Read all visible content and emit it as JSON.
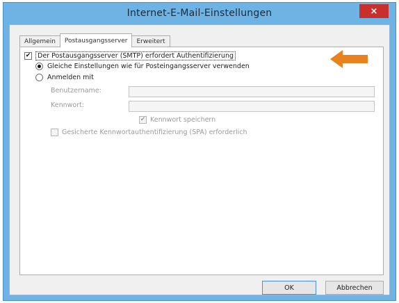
{
  "window": {
    "title": "Internet-E-Mail-Einstellungen",
    "close_glyph": "×"
  },
  "tabs": [
    {
      "label": "Allgemein",
      "active": false
    },
    {
      "label": "Postausgangsserver",
      "active": true
    },
    {
      "label": "Erweitert",
      "active": false
    }
  ],
  "smtp_auth": {
    "label": "Der Postausgangsserver (SMTP) erfordert Authentifizierung",
    "checked": true,
    "checkmark": "✔"
  },
  "options": {
    "same_settings": {
      "label": "Gleiche Einstellungen wie für Posteingangsserver verwenden",
      "selected": true
    },
    "login_with": {
      "label": "Anmelden mit",
      "selected": false
    }
  },
  "fields": {
    "username_label": "Benutzername:",
    "password_label": "Kennwort:",
    "username_value": "",
    "password_value": ""
  },
  "save_password": {
    "label": "Kennwort speichern",
    "checked": true,
    "checkmark": "✔"
  },
  "spa": {
    "label": "Gesicherte Kennwortauthentifizierung (SPA) erforderlich",
    "checked": false
  },
  "buttons": {
    "ok": "OK",
    "cancel": "Abbrechen"
  },
  "colors": {
    "arrow": "#e8821e",
    "titlebar": "#6fb2e4",
    "close": "#c9302c"
  }
}
